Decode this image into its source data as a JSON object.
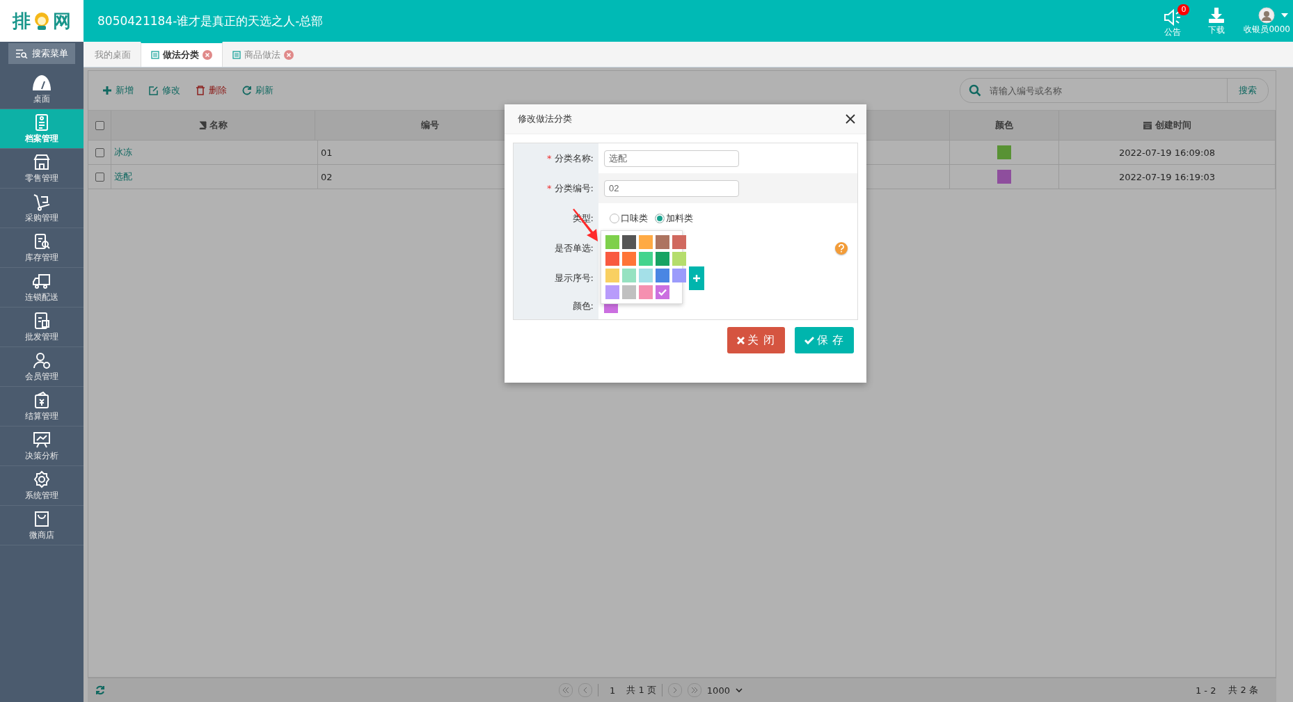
{
  "header": {
    "logo_left": "排",
    "logo_right": "网",
    "title": "8050421184-谁才是真正的天选之人-总部",
    "notice_count": "0",
    "notice_label": "公告",
    "download_label": "下载",
    "user_label": "收银员0000"
  },
  "sidebar": {
    "search": "搜索菜单",
    "items": [
      {
        "label": "桌面",
        "selected": false
      },
      {
        "label": "档案管理",
        "selected": true
      },
      {
        "label": "零售管理",
        "selected": false
      },
      {
        "label": "采购管理",
        "selected": false
      },
      {
        "label": "库存管理",
        "selected": false
      },
      {
        "label": "连锁配送",
        "selected": false
      },
      {
        "label": "批发管理",
        "selected": false
      },
      {
        "label": "会员管理",
        "selected": false
      },
      {
        "label": "结算管理",
        "selected": false
      },
      {
        "label": "决策分析",
        "selected": false
      },
      {
        "label": "系统管理",
        "selected": false
      },
      {
        "label": "微商店",
        "selected": false
      }
    ]
  },
  "tabs": [
    {
      "label": "我的桌面",
      "selected": false,
      "closable": false
    },
    {
      "label": "做法分类",
      "selected": true,
      "closable": true
    },
    {
      "label": "商品做法",
      "selected": false,
      "closable": true
    }
  ],
  "toolbar": [
    {
      "label": "新增",
      "kind": "add"
    },
    {
      "label": "修改",
      "kind": "edit"
    },
    {
      "label": "删除",
      "kind": "delete"
    },
    {
      "label": "刷新",
      "kind": "refresh"
    }
  ],
  "search": {
    "placeholder": "请输入编号或名称",
    "button": "搜索"
  },
  "table": {
    "all_checked": false,
    "columns": {
      "name_header": "名称",
      "code_header": "编号",
      "swatch_header": "颜色",
      "created_header": "创建时间"
    },
    "rows": [
      {
        "checked": false,
        "name": "冰冻",
        "code": "01",
        "color": "#589234",
        "created": "2022-07-19 16:09:08"
      },
      {
        "checked": false,
        "name": "选配",
        "code": "02",
        "color": "#8e4e9d",
        "created": "2022-07-19 16:19:03"
      }
    ]
  },
  "pager": {
    "page": "1",
    "total_pages": "共 1 页",
    "page_size": "1000",
    "range": "1 - 2",
    "total": "共 2 条"
  },
  "dialog": {
    "title": "修改做法分类",
    "required_mark": "*",
    "name_label": "分类名称:",
    "name_value": "选配",
    "code_label": "分类编号:",
    "code_value": "02",
    "type_label": "类型:",
    "type_options": [
      {
        "label": "口味类",
        "selected": false
      },
      {
        "label": "加料类",
        "selected": true
      }
    ],
    "single_label": "是否单选:",
    "order_label": "显示序号:",
    "color_label": "颜色:",
    "chosen": {
      "color": "#cb6fe0"
    },
    "palette": [
      {
        "color": "#7ed04b",
        "selected": false
      },
      {
        "color": "#555555",
        "selected": false
      },
      {
        "color": "#ffaa44",
        "selected": false
      },
      {
        "color": "#ad7460",
        "selected": false
      },
      {
        "color": "#d0695f",
        "selected": false
      },
      {
        "color": "#f95a40",
        "selected": false
      },
      {
        "color": "#ff7537",
        "selected": false
      },
      {
        "color": "#43d48e",
        "selected": false
      },
      {
        "color": "#17a363",
        "selected": false
      },
      {
        "color": "#b5dd6c",
        "selected": false
      },
      {
        "color": "#f9d062",
        "selected": false
      },
      {
        "color": "#96e2c1",
        "selected": false
      },
      {
        "color": "#a4e0e8",
        "selected": false
      },
      {
        "color": "#4a86e3",
        "selected": false
      },
      {
        "color": "#9b9bfb",
        "selected": false
      },
      {
        "color": "#b89bfb",
        "selected": false
      },
      {
        "color": "#c0c0c0",
        "selected": false
      },
      {
        "color": "#f590b0",
        "selected": false
      },
      {
        "color": "#cb6fe0",
        "selected": true
      }
    ],
    "close_button": "关 闭",
    "save_button": "保 存"
  }
}
